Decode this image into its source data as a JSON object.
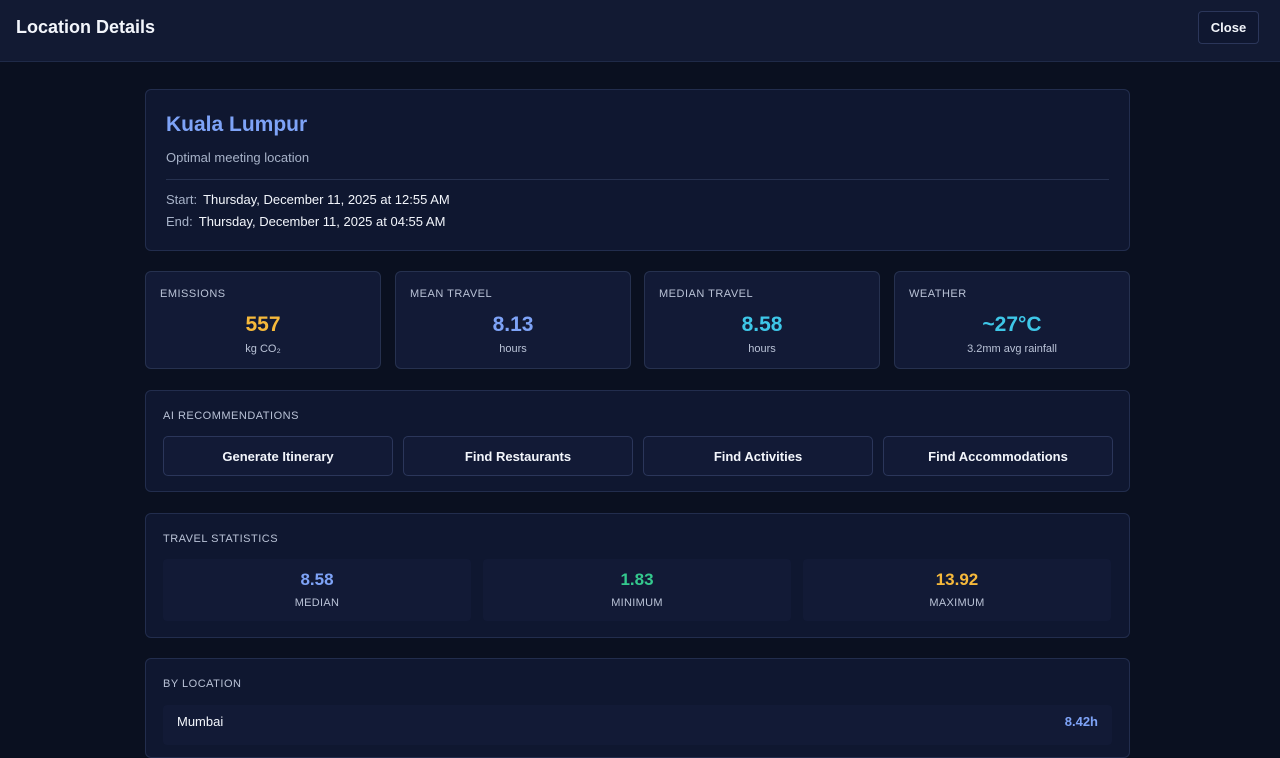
{
  "header": {
    "title": "Location Details",
    "close_label": "Close"
  },
  "location": {
    "name": "Kuala Lumpur",
    "subtitle": "Optimal meeting location",
    "start_label": "Start:",
    "start_value": "Thursday, December 11, 2025 at 12:55 AM",
    "end_label": "End:",
    "end_value": "Thursday, December 11, 2025 at 04:55 AM"
  },
  "stats": [
    {
      "label": "EMISSIONS",
      "value": "557",
      "unit": "kg CO₂",
      "color": "#f6b93b"
    },
    {
      "label": "MEAN TRAVEL",
      "value": "8.13",
      "unit": "hours",
      "color": "#7ea3f7"
    },
    {
      "label": "MEDIAN TRAVEL",
      "value": "8.58",
      "unit": "hours",
      "color": "#3ec7e8"
    },
    {
      "label": "WEATHER",
      "value": "~27°C",
      "unit": "3.2mm avg rainfall",
      "color": "#3ec7e8"
    }
  ],
  "ai": {
    "label": "AI RECOMMENDATIONS",
    "buttons": [
      "Generate Itinerary",
      "Find Restaurants",
      "Find Activities",
      "Find Accommodations"
    ]
  },
  "travel": {
    "label": "TRAVEL STATISTICS",
    "items": [
      {
        "value": "8.58",
        "label": "MEDIAN",
        "color": "#7ea3f7"
      },
      {
        "value": "1.83",
        "label": "MINIMUM",
        "color": "#34c98e"
      },
      {
        "value": "13.92",
        "label": "MAXIMUM",
        "color": "#f6b93b"
      }
    ]
  },
  "by_location": {
    "label": "BY LOCATION",
    "rows": [
      {
        "name": "Mumbai",
        "value": "8.42h"
      }
    ]
  }
}
